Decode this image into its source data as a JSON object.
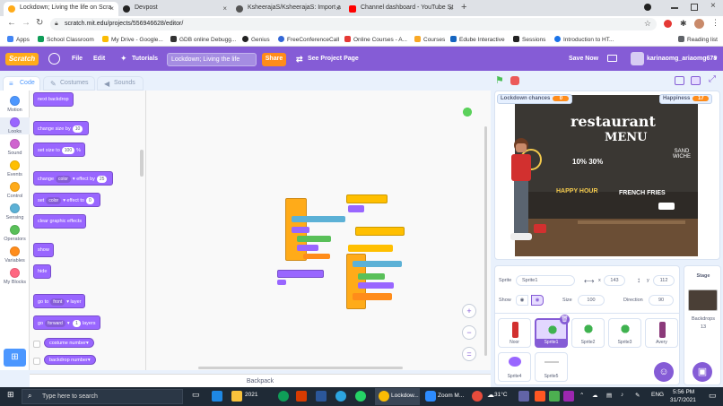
{
  "browser": {
    "tabs": [
      {
        "title": "Lockdown; Living the life on Scra",
        "active": true,
        "color": "#ffab1a"
      },
      {
        "title": "Devpost",
        "active": false,
        "color": "#222222"
      },
      {
        "title": "KsheerajaS/KsheerajaS: Import a",
        "active": false,
        "color": "#555555"
      },
      {
        "title": "Channel dashboard - YouTube St",
        "active": false,
        "color": "#ff0000"
      }
    ],
    "new_tab": "+",
    "url": "scratch.mit.edu/projects/556946628/editor/",
    "bookmarks": [
      "Apps",
      "School Classroom",
      "My Drive - Google...",
      "GDB online Debugg...",
      "Genius",
      "FreeConferenceCall",
      "Online Courses - A...",
      "Courses",
      "Edube Interactive",
      "Sessions",
      "Introduction to HT...",
      "Reading list"
    ]
  },
  "menu": {
    "logo": "Scratch",
    "file": "File",
    "edit": "Edit",
    "tutorials": "Tutorials",
    "project_title": "Lockdown; Living the life",
    "share": "Share",
    "see_project_page": "See Project Page",
    "save_now": "Save Now",
    "username": "karinaomg_ariaomg678"
  },
  "editor_tabs": {
    "code": "Code",
    "costumes": "Costumes",
    "sounds": "Sounds"
  },
  "categories": [
    {
      "label": "Motion",
      "color": "#4c97ff"
    },
    {
      "label": "Looks",
      "color": "#9966ff"
    },
    {
      "label": "Sound",
      "color": "#cf63cf"
    },
    {
      "label": "Events",
      "color": "#ffbf00"
    },
    {
      "label": "Control",
      "color": "#ffab19"
    },
    {
      "label": "Sensing",
      "color": "#5cb1d6"
    },
    {
      "label": "Operators",
      "color": "#59c059"
    },
    {
      "label": "Variables",
      "color": "#ff8c1a"
    },
    {
      "label": "My Blocks",
      "color": "#ff6680"
    }
  ],
  "palette": {
    "next_backdrop": "next backdrop",
    "change_size": "change size by",
    "change_size_val": "10",
    "set_size": "set size to",
    "set_size_val": "100",
    "set_size_unit": "%",
    "change": "change",
    "change_effect": "color",
    "effect_by": "effect by",
    "change_effect_val": "25",
    "set": "set",
    "set_effect": "color",
    "effect_to": "effect to",
    "set_effect_val": "0",
    "clear_effects": "clear graphic effects",
    "show": "show",
    "hide": "hide",
    "go_to": "go to",
    "layer_front": "front",
    "layer": "layer",
    "go": "go",
    "forward": "forward",
    "layers_val": "1",
    "layers": "layers",
    "costume": "costume",
    "backdrop": "backdrop",
    "number": "number"
  },
  "backpack": "Backpack",
  "stage": {
    "monitor1_label": "Lockdown chances",
    "monitor1_value": "0",
    "monitor2_label": "Happiness",
    "monitor2_value": "17",
    "backdrop_text": [
      "restaurant",
      "MENU",
      "10% 30%",
      "SAND WICHE",
      "HAPPY HOUR",
      "FRENCH FRIES"
    ]
  },
  "sprite_info": {
    "sprite_label": "Sprite",
    "sprite_name": "Sprite1",
    "x_label": "x",
    "x": "143",
    "y_label": "y",
    "y": "112",
    "show_label": "Show",
    "size_label": "Size",
    "size": "100",
    "direction_label": "Direction",
    "direction": "90"
  },
  "sprites": [
    "Noor",
    "Sprite1",
    "Sprite2",
    "Sprite3",
    "Avery",
    "Sprite4",
    "Sprite5"
  ],
  "stage_pane": {
    "title": "Stage",
    "backdrops_label": "Backdrops",
    "backdrops_count": "13"
  },
  "taskbar": {
    "search": "Type here to search",
    "folder": "2021",
    "chrome_item": "Lockdow...",
    "zoom_item": "Zoom M...",
    "weather": "31°C",
    "lang": "ENG",
    "time": "5:56 PM",
    "date": "31/7/2021"
  }
}
